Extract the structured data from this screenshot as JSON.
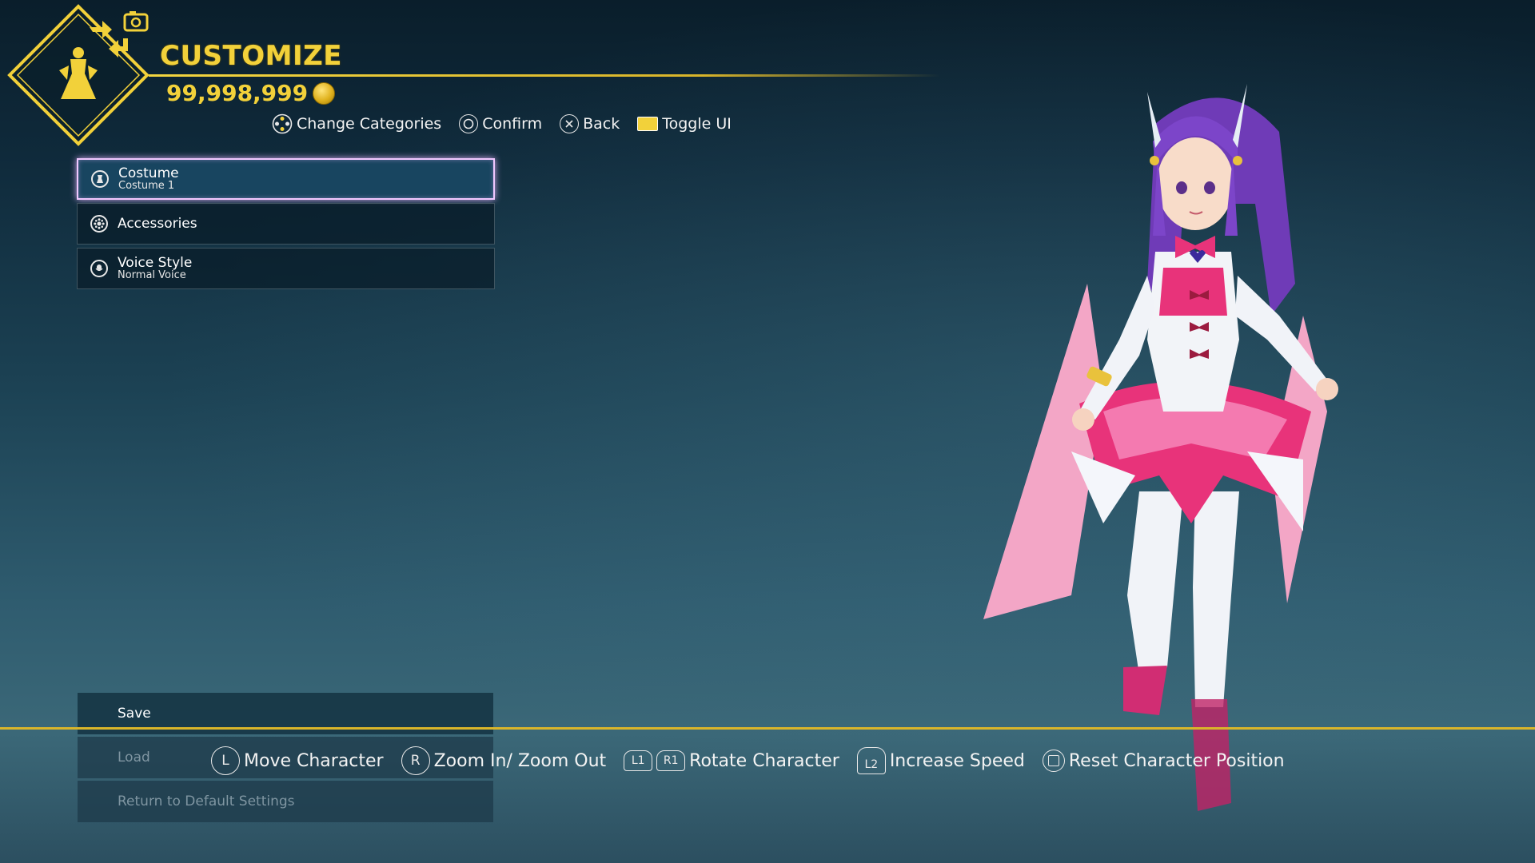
{
  "header": {
    "title": "CUSTOMIZE",
    "currency": "99,998,999"
  },
  "top_controls": [
    {
      "icon": "dpad-icon",
      "label": "Change Categories"
    },
    {
      "icon": "circle-button-icon",
      "label": "Confirm"
    },
    {
      "icon": "cross-button-icon",
      "label": "Back"
    },
    {
      "icon": "touchpad-icon",
      "label": "Toggle UI"
    }
  ],
  "menu": [
    {
      "label": "Costume",
      "sub": "Costume 1",
      "icon": "costume-icon",
      "selected": true
    },
    {
      "label": "Accessories",
      "sub": "",
      "icon": "accessories-icon",
      "selected": false
    },
    {
      "label": "Voice Style",
      "sub": "Normal Voice",
      "icon": "voice-icon",
      "selected": false
    }
  ],
  "actions": [
    {
      "label": "Save",
      "enabled": true
    },
    {
      "label": "Load",
      "enabled": false
    },
    {
      "label": "Return to Default Settings",
      "enabled": false
    }
  ],
  "bottom_controls": {
    "move": {
      "button": "L",
      "label": "Move Character"
    },
    "zoom": {
      "button": "R",
      "label": "Zoom In/ Zoom Out"
    },
    "rotate": {
      "button_l": "L1",
      "button_r": "R1",
      "label": "Rotate Character"
    },
    "speed": {
      "button": "L2",
      "label": "Increase Speed"
    },
    "reset": {
      "label": "Reset Character Position"
    }
  },
  "colors": {
    "accent_gold": "#f2d13a",
    "selected_glow": "#f0c7ff",
    "costume_pink": "#e8337a",
    "hair_purple": "#7a3fc0"
  }
}
